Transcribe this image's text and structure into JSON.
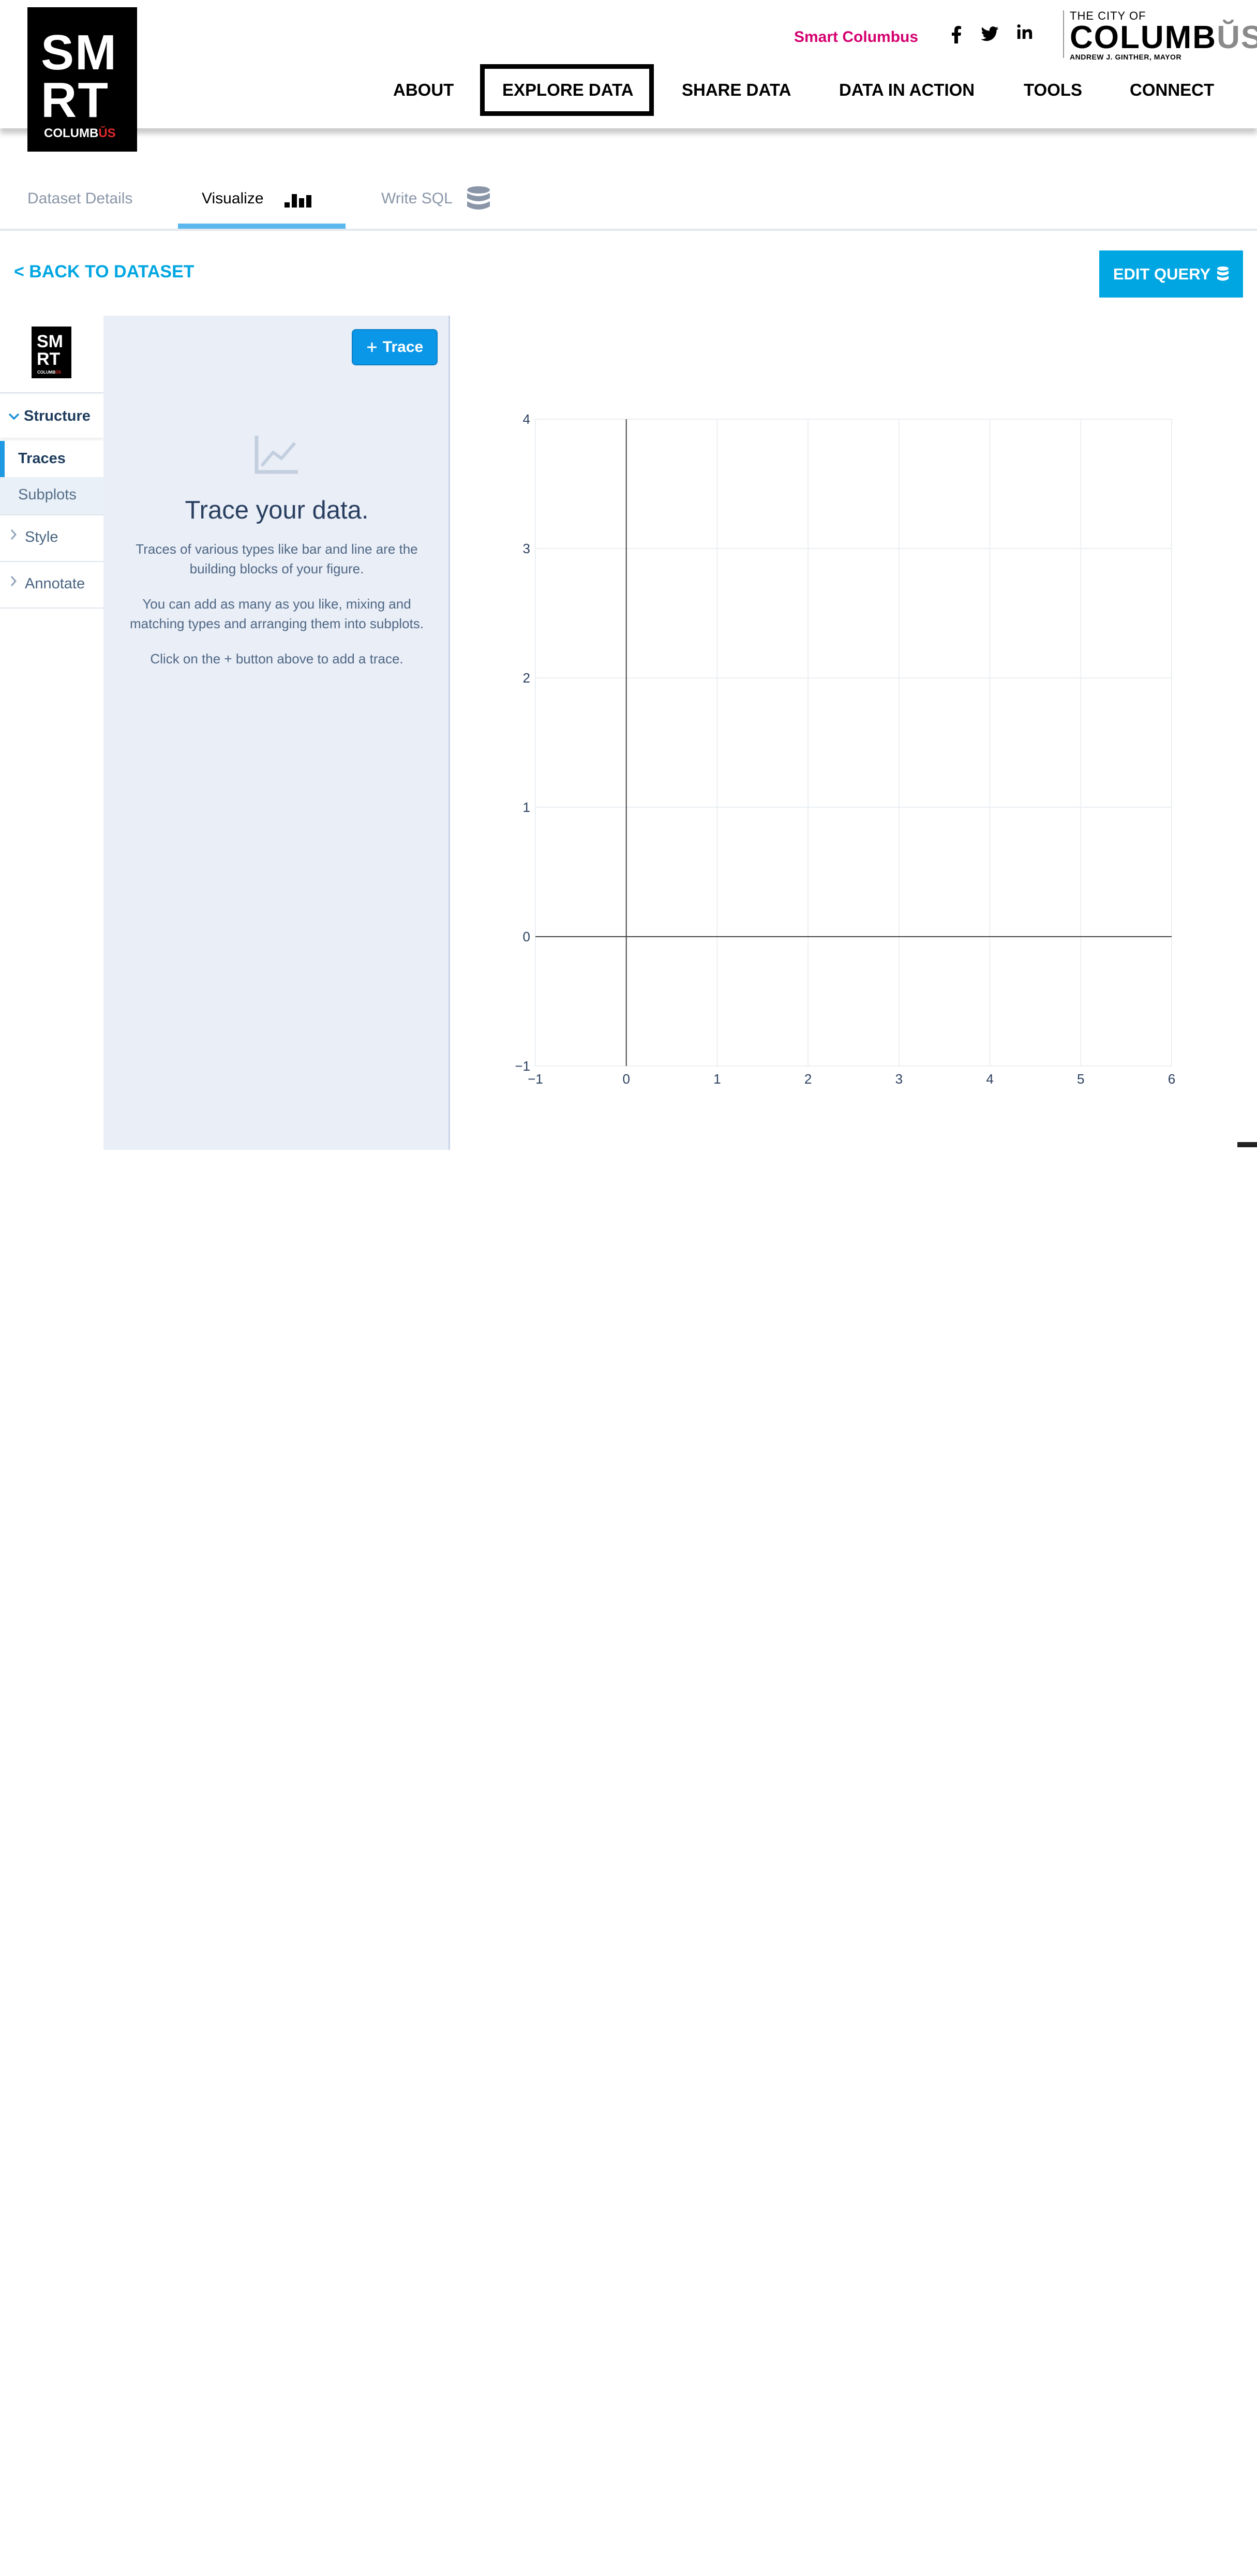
{
  "header": {
    "logo_line1": "SM",
    "logo_line2": "RT",
    "logo_small_a": "COLUMB",
    "logo_small_b": "ŬS",
    "top_link": "Smart Columbus",
    "social": [
      "f",
      "t",
      "in"
    ],
    "city_line1": "THE CITY OF",
    "city_line2a": "COLUMB",
    "city_line2b": "ŬS",
    "city_line3": "ANDREW J. GINTHER, MAYOR",
    "nav": [
      "ABOUT",
      "EXPLORE DATA",
      "SHARE DATA",
      "DATA IN ACTION",
      "TOOLS",
      "CONNECT"
    ],
    "active_nav": "EXPLORE DATA"
  },
  "tabs": [
    {
      "label": "Dataset Details",
      "icon": ""
    },
    {
      "label": "Visualize",
      "icon": "bar-chart-icon"
    },
    {
      "label": "Write SQL",
      "icon": "database-icon"
    }
  ],
  "active_tab": "Visualize",
  "back_link": "< BACK TO DATASET",
  "edit_query": "EDIT QUERY",
  "sidebar": {
    "logo_line1": "SM",
    "logo_line2": "RT",
    "logo_small_a": "COLUMB",
    "logo_small_b": "ŬS",
    "structure": "Structure",
    "traces": "Traces",
    "subplots": "Subplots",
    "style": "Style",
    "annotate": "Annotate"
  },
  "panel": {
    "add_button": "Trace",
    "title": "Trace your data.",
    "p1": "Traces of various types like bar and line are the building blocks of your figure.",
    "p2": "You can add as many as you like, mixing and matching types and arranging them into subplots.",
    "p3": "Click on the + button above to add a trace."
  },
  "colors": {
    "accent": "#00a6e2",
    "brand_pink": "#d4006f",
    "panel_bg": "#e9eef7",
    "button_blue": "#0b97e8"
  },
  "chart_data": {
    "type": "scatter",
    "series": [],
    "xlim": [
      -1,
      6
    ],
    "ylim": [
      -1,
      4
    ],
    "x_ticks": [
      "−1",
      "0",
      "1",
      "2",
      "3",
      "4",
      "5",
      "6"
    ],
    "y_ticks": [
      "−1",
      "0",
      "1",
      "2",
      "3",
      "4"
    ],
    "grid": true
  }
}
